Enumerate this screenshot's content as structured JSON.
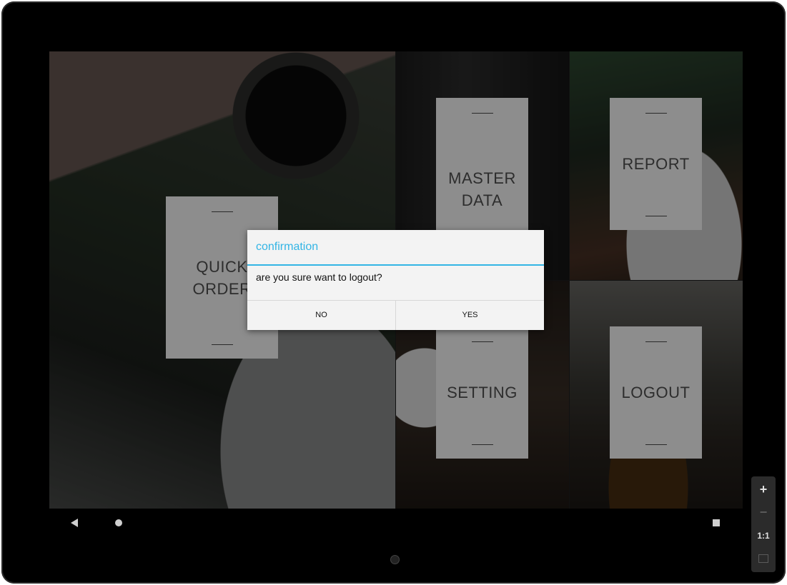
{
  "tiles": {
    "quick_order": "QUICK\nORDER",
    "master_data": "MASTER\nDATA",
    "report": "REPORT",
    "setting": "SETTING",
    "logout": "LOGOUT"
  },
  "dialog": {
    "title": "confirmation",
    "message": "are you sure want to logout?",
    "no_label": "NO",
    "yes_label": "YES"
  },
  "emulator": {
    "zoom_in": "+",
    "zoom_out": "−",
    "actual_size": "1:1"
  },
  "colors": {
    "accent": "#33b5e5",
    "card": "#8d8d8d"
  }
}
